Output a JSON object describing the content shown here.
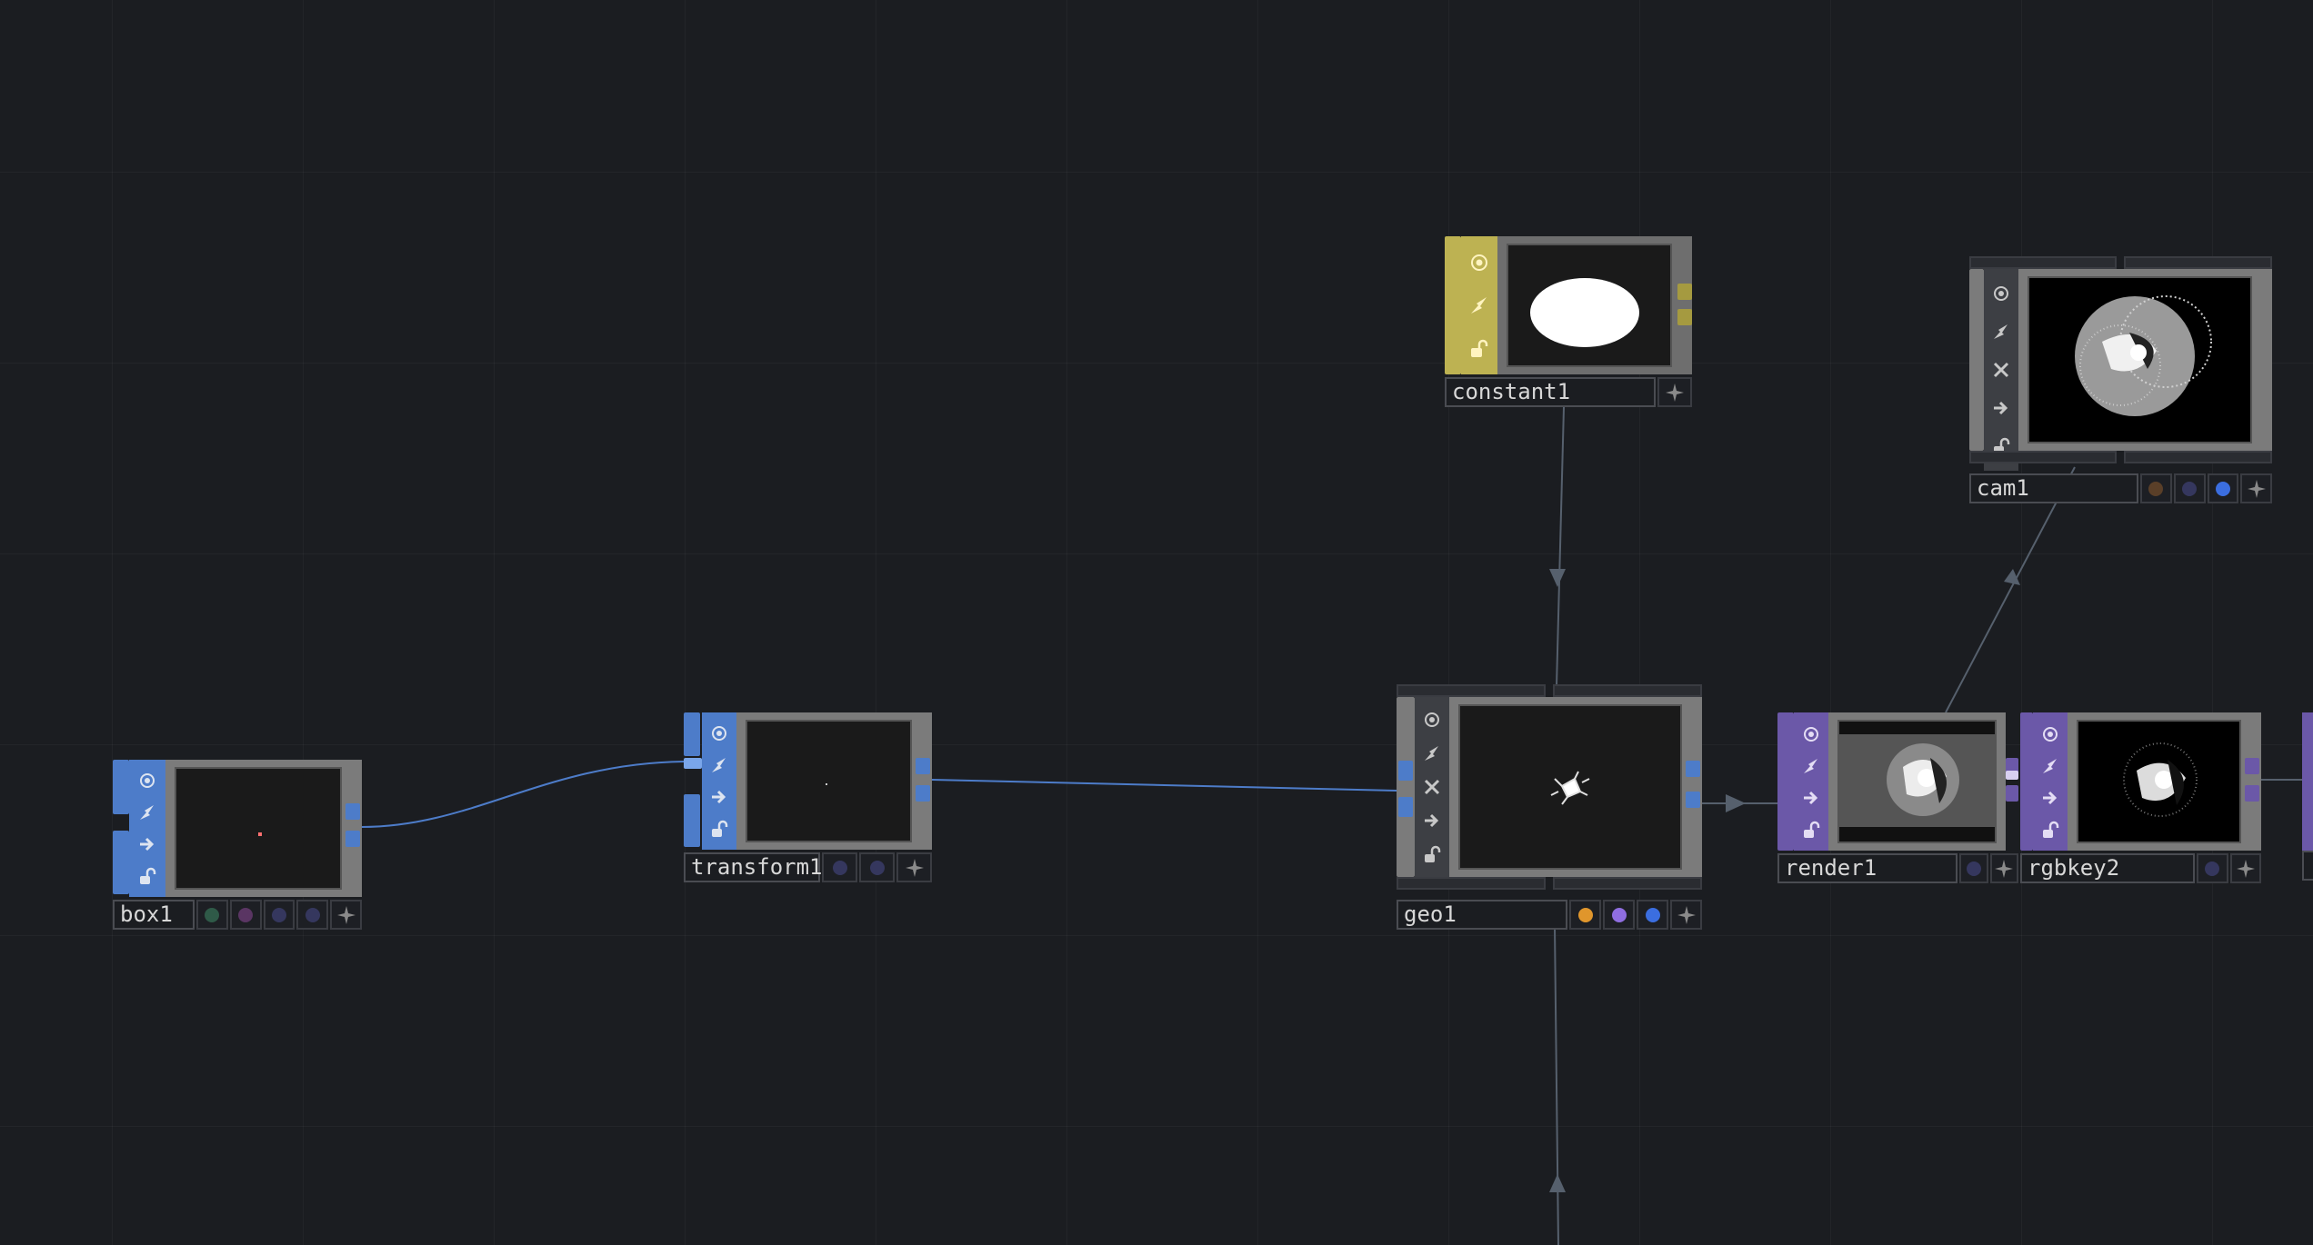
{
  "colors": {
    "background": "#1b1d21",
    "sop": "#4d7cc9",
    "top": "#6b58a8",
    "chop": "#bdb252",
    "comp": "#6a6a6a",
    "wire_blue": "#4d7cc9",
    "wire_gray": "#56606d"
  },
  "nodes": {
    "box1": {
      "label": "box1",
      "type": "SOP",
      "flags": [
        "#2f7d5a",
        "#6e3b78",
        "#3b3d78",
        "#3b3d78"
      ]
    },
    "transform1": {
      "label": "transform1",
      "type": "SOP",
      "flags": [
        "#3b3d78",
        "#3b3d78"
      ]
    },
    "constant1": {
      "label": "constant1",
      "type": "CHOP",
      "flags": []
    },
    "cam1": {
      "label": "cam1",
      "type": "COMP",
      "flags": [
        "#6e4a2c",
        "#3b3d78",
        "#3b6ee0"
      ]
    },
    "geo1": {
      "label": "geo1",
      "type": "COMP",
      "flags": [
        "#e0962c",
        "#8f6ee0",
        "#3b6ee0"
      ]
    },
    "render1": {
      "label": "render1",
      "type": "TOP",
      "flags": [
        "#3b3d78"
      ]
    },
    "rgbkey2": {
      "label": "rgbkey2",
      "type": "TOP",
      "flags": [
        "#3b3d78"
      ]
    }
  },
  "icons": {
    "viewer": "viewer-icon",
    "cook": "cook-icon",
    "bypass": "bypass-icon",
    "display": "display-icon",
    "lock": "lock-icon",
    "add": "add-icon"
  }
}
